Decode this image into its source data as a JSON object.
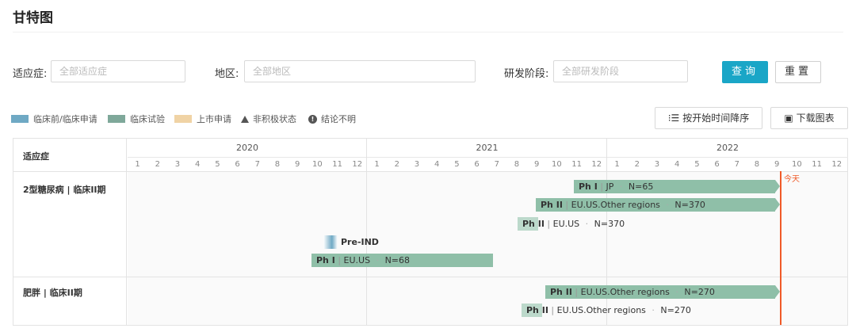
{
  "page": {
    "title": "甘特图"
  },
  "filters": {
    "indication_label": "适应症:",
    "indication_placeholder": "全部适应症",
    "region_label": "地区:",
    "region_placeholder": "全部地区",
    "phase_label": "研发阶段:",
    "phase_placeholder": "全部研发阶段",
    "search_label": "查询",
    "reset_label": "重置"
  },
  "legend": {
    "preclinical": "临床前/临床申请",
    "clinical": "临床试验",
    "market": "上市申请",
    "inactive": "非积极状态",
    "unknown": "结论不明",
    "colors": {
      "preclinical": "#6fa9c4",
      "clinical": "#7fa89a",
      "market": "#f0d3a5"
    }
  },
  "toolbar": {
    "sort_label": "按开始时间降序",
    "download_label": "下载图表"
  },
  "gantt": {
    "header_left": "适应症",
    "years": [
      "2020",
      "2021",
      "2022"
    ],
    "months": [
      "1",
      "2",
      "3",
      "4",
      "5",
      "6",
      "7",
      "8",
      "9",
      "10",
      "11",
      "12"
    ],
    "today_label": "今天",
    "rows": [
      {
        "label": "2型糖尿病 | 临床II期",
        "bars": [
          {
            "phase": "Ph I",
            "region": "JP",
            "n": "N=65"
          },
          {
            "phase": "Ph II",
            "region": "EU.US.Other regions",
            "n": "N=370"
          },
          {
            "phase": "Ph II",
            "region": "EU.US",
            "n": "N=370"
          },
          {
            "phase": "Pre-IND"
          },
          {
            "phase": "Ph I",
            "region": "EU.US",
            "n": "N=68"
          }
        ]
      },
      {
        "label": "肥胖 | 临床II期",
        "bars": [
          {
            "phase": "Ph II",
            "region": "EU.US.Other regions",
            "n": "N=270"
          },
          {
            "phase": "Ph II",
            "region": "EU.US.Other regions",
            "n": "N=270"
          }
        ]
      }
    ]
  }
}
